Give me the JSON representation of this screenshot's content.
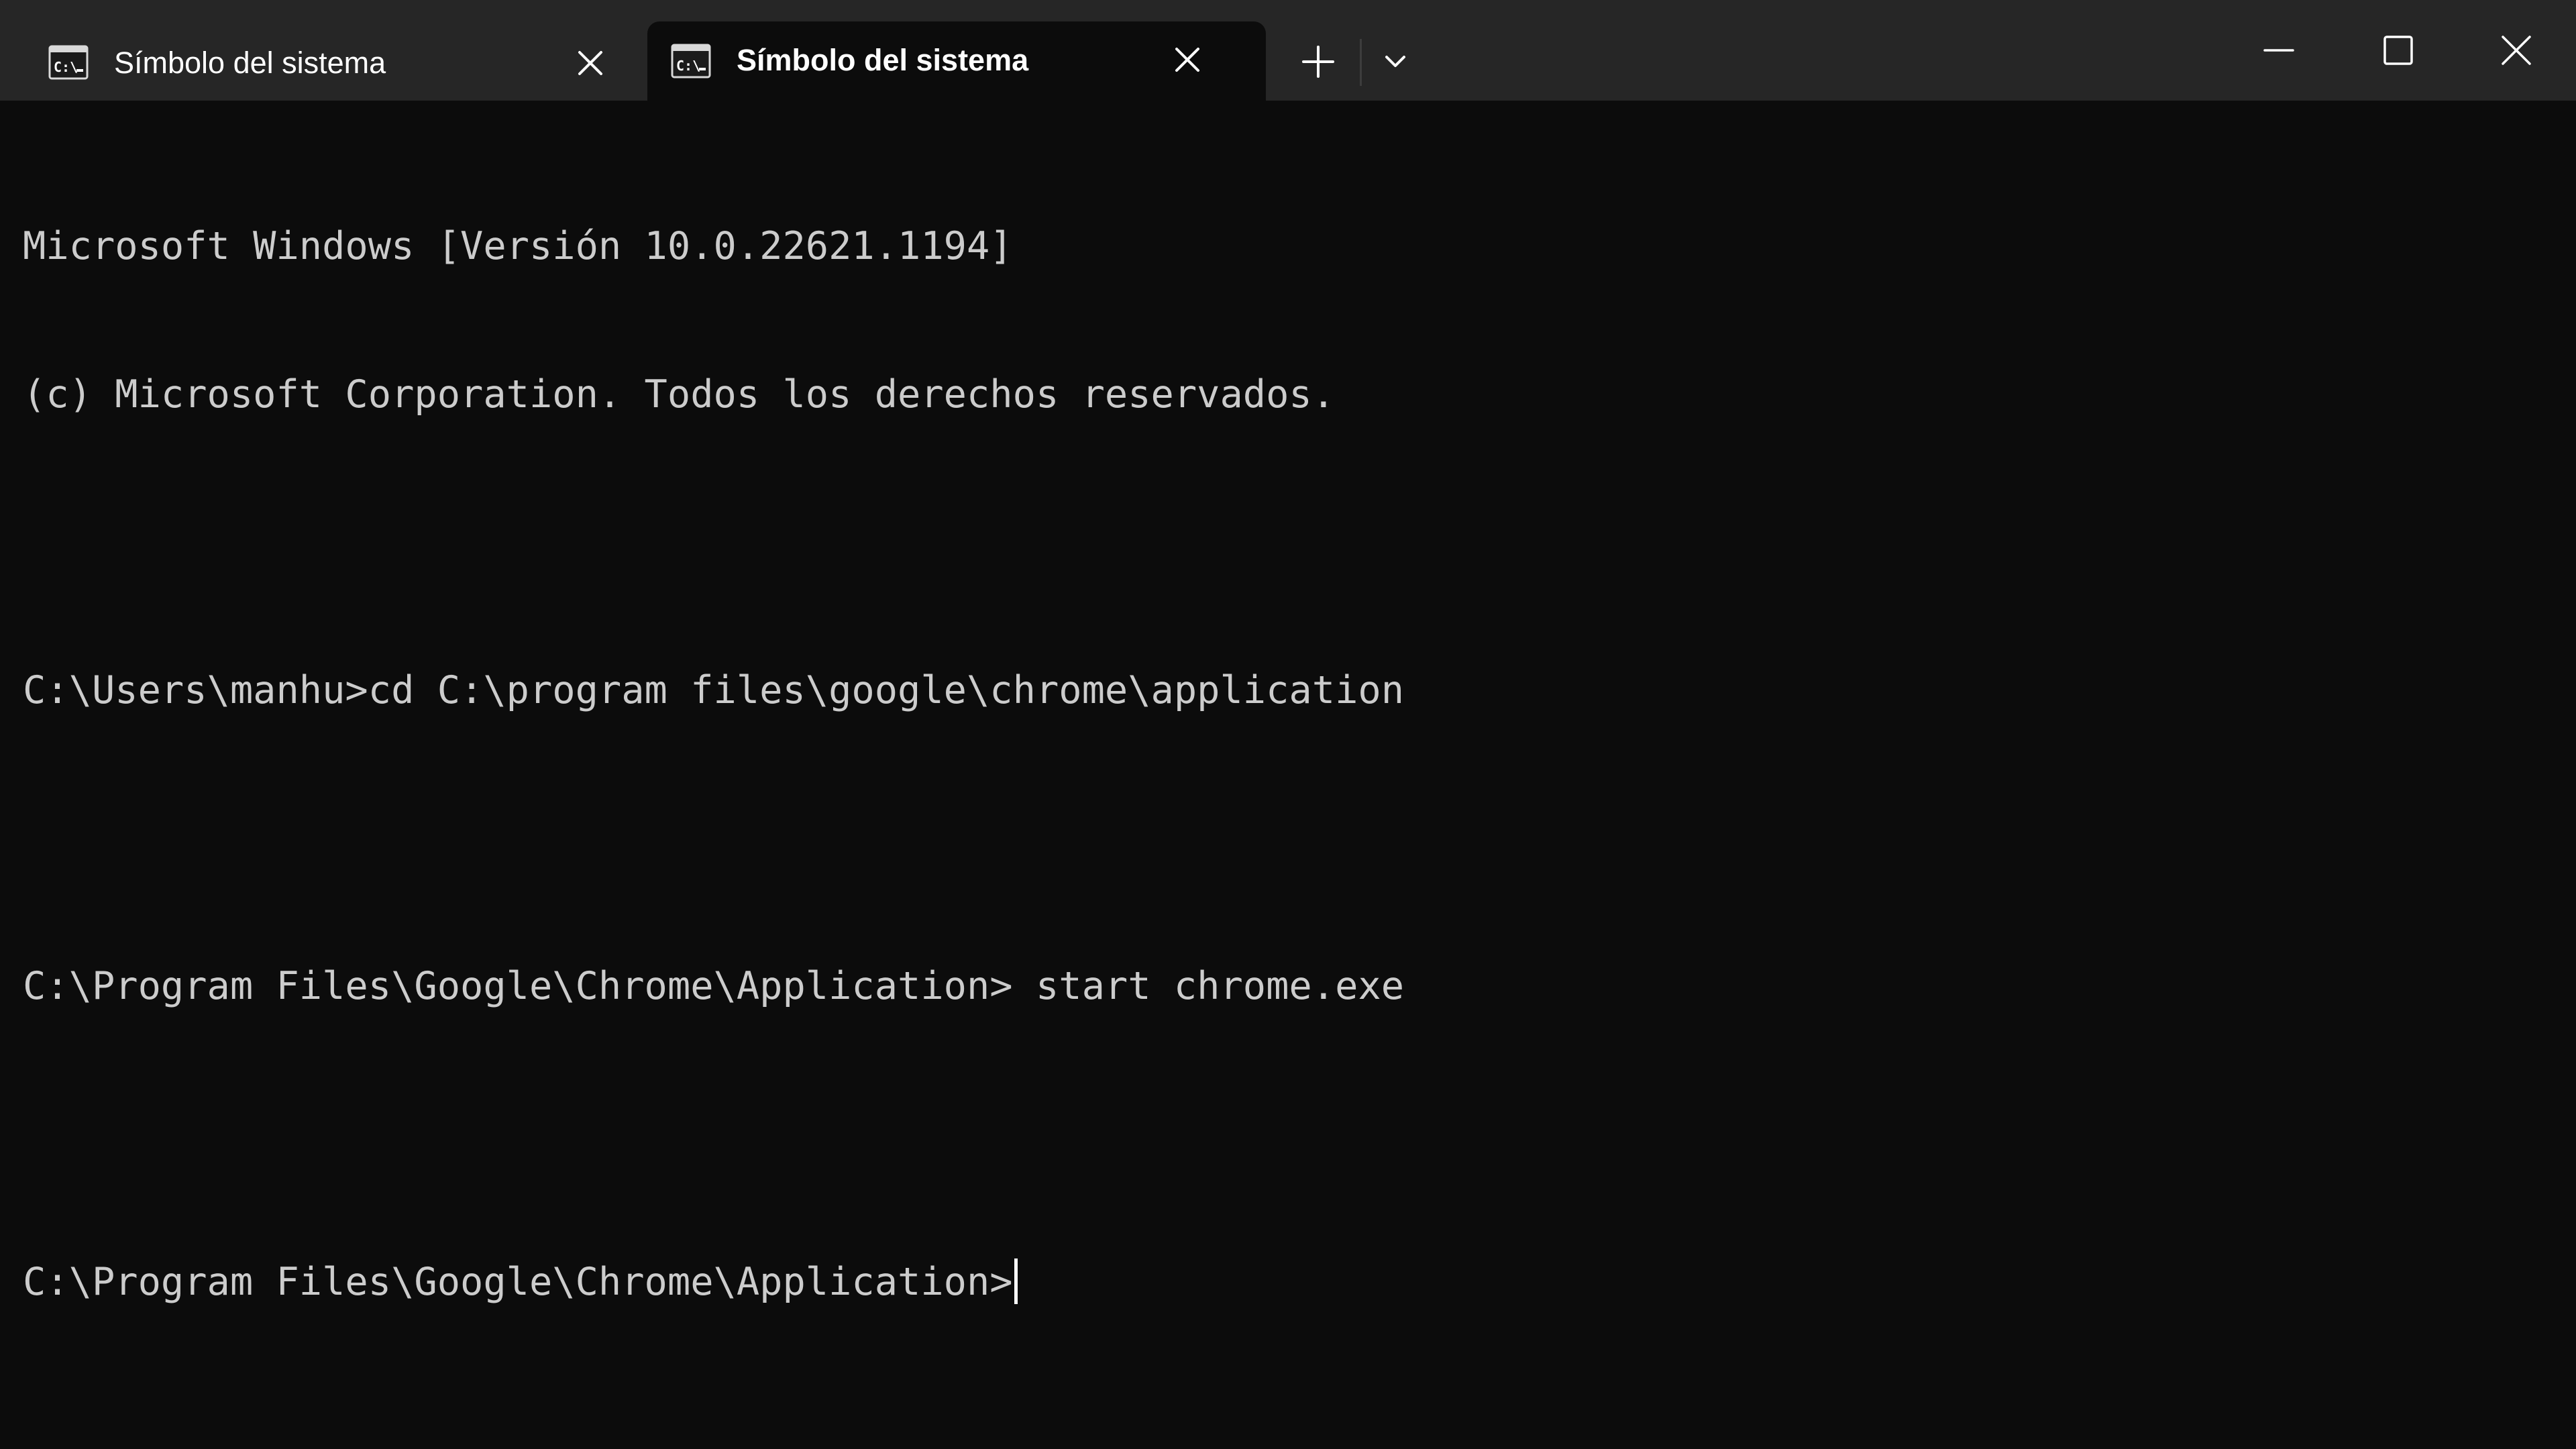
{
  "tabs": [
    {
      "title": "Símbolo del sistema",
      "icon": "command-prompt-icon",
      "active": false
    },
    {
      "title": "Símbolo del sistema",
      "icon": "command-prompt-icon",
      "active": true
    }
  ],
  "tab_icon_text": "C:\\",
  "titlebar": {
    "new_tab_icon": "plus-icon",
    "dropdown_icon": "chevron-down-icon",
    "minimize_icon": "minimize-icon",
    "maximize_icon": "maximize-icon",
    "close_icon": "close-icon"
  },
  "terminal": {
    "lines": [
      "Microsoft Windows [Versión 10.0.22621.1194]",
      "(c) Microsoft Corporation. Todos los derechos reservados.",
      "",
      "C:\\Users\\manhu>cd C:\\program files\\google\\chrome\\application",
      "",
      "C:\\Program Files\\Google\\Chrome\\Application> start chrome.exe",
      ""
    ],
    "prompt": "C:\\Program Files\\Google\\Chrome\\Application>"
  },
  "colors": {
    "titlebar_bg": "#262626",
    "terminal_bg": "#0c0c0c",
    "terminal_text": "#cccccc",
    "tab_text": "#ffffff"
  }
}
